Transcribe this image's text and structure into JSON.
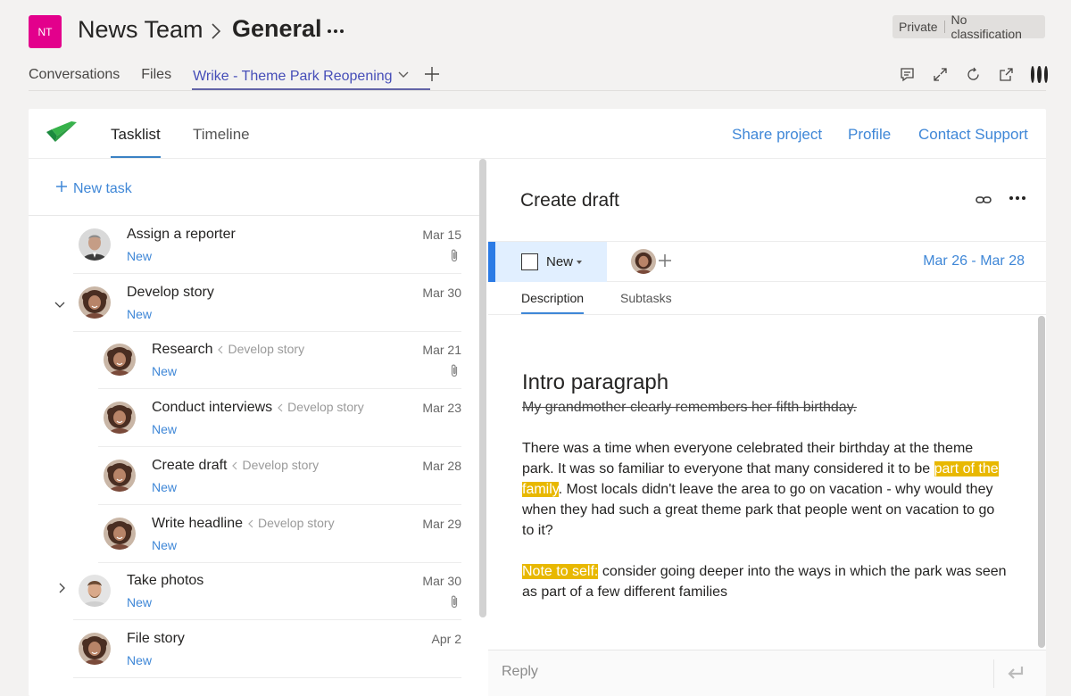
{
  "header": {
    "team_initials": "NT",
    "team_name": "News Team",
    "channel_name": "General",
    "privacy": "Private",
    "classification": "No classification"
  },
  "tabs": [
    {
      "label": "Conversations"
    },
    {
      "label": "Files"
    },
    {
      "label": "Wrike - Theme Park Reopening",
      "active": true
    }
  ],
  "app": {
    "tabs": [
      "Tasklist",
      "Timeline"
    ],
    "links": [
      "Share project",
      "Profile",
      "Contact Support"
    ],
    "new_task_label": "New task"
  },
  "tasks": [
    {
      "name": "Assign a reporter",
      "parent": "",
      "status": "New",
      "date": "Mar 15",
      "attachment": true,
      "avatar": "man"
    },
    {
      "name": "Develop story",
      "parent": "",
      "status": "New",
      "date": "Mar 30",
      "attachment": false,
      "avatar": "woman",
      "expanded": true
    },
    {
      "name": "Research",
      "parent": "Develop story",
      "status": "New",
      "date": "Mar 21",
      "attachment": true,
      "avatar": "woman"
    },
    {
      "name": "Conduct interviews",
      "parent": "Develop story",
      "status": "New",
      "date": "Mar 23",
      "attachment": false,
      "avatar": "woman"
    },
    {
      "name": "Create draft",
      "parent": "Develop story",
      "status": "New",
      "date": "Mar 28",
      "attachment": false,
      "avatar": "woman"
    },
    {
      "name": "Write headline",
      "parent": "Develop story",
      "status": "New",
      "date": "Mar 29",
      "attachment": false,
      "avatar": "woman"
    },
    {
      "name": "Take photos",
      "parent": "",
      "status": "New",
      "date": "Mar 30",
      "attachment": true,
      "avatar": "man2",
      "expanded": false
    },
    {
      "name": "File story",
      "parent": "",
      "status": "New",
      "date": "Apr 2",
      "attachment": false,
      "avatar": "woman"
    }
  ],
  "detail": {
    "title": "Create draft",
    "status": "New",
    "date_range": "Mar 26 - Mar 28",
    "tabs": [
      "Description",
      "Subtasks"
    ],
    "heading": "Intro paragraph",
    "struck": "My grandmother clearly remembers her fifth birthday.",
    "para1_a": "There was a time when everyone celebrated their birthday at the theme park. It was so familiar to everyone that many considered it to be ",
    "para1_hl": "part of the family",
    "para1_b": ". Most locals didn't leave the area to go on vacation - why would they when they had such a great theme park that people went on vacation to go to it?",
    "para2_hl": "Note to self:",
    "para2_b": " consider going deeper into the ways in which the park was seen as part of a few different families",
    "reply_placeholder": "Reply"
  },
  "colors": {
    "team_avatar": "#e3008c",
    "teams_accent": "#6264a7",
    "wrike_blue": "#3f87d7",
    "highlight": "#e8b800",
    "wrike_green": "#2ea44f"
  }
}
